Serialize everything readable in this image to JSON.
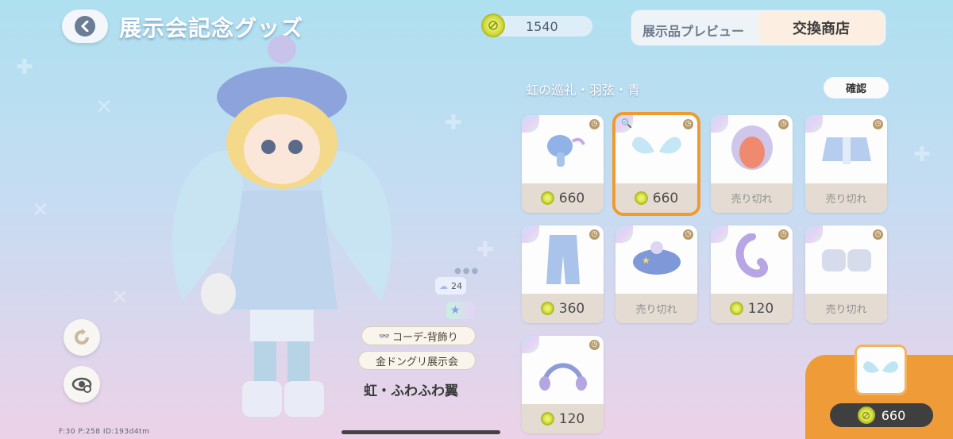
{
  "header": {
    "title": "展示会記念グッズ",
    "currency": "1540"
  },
  "tabs": {
    "preview": "展示品プレビュー",
    "shop": "交換商店"
  },
  "set_name": "虹の巡礼・羽弦・青",
  "confirm_label": "確認",
  "items": [
    {
      "name": "ribbon-hairdryer",
      "price": "660",
      "soldout": false,
      "selected": false
    },
    {
      "name": "angel-wings",
      "price": "660",
      "soldout": false,
      "selected": true
    },
    {
      "name": "lavender-bob-hair",
      "price": "",
      "soldout": true,
      "selected": false
    },
    {
      "name": "blue-jacket-top",
      "price": "",
      "soldout": true,
      "selected": false
    },
    {
      "name": "blue-pants",
      "price": "360",
      "soldout": false,
      "selected": false
    },
    {
      "name": "star-beret",
      "price": "",
      "soldout": true,
      "selected": false
    },
    {
      "name": "purple-ponytail",
      "price": "120",
      "soldout": false,
      "selected": false
    },
    {
      "name": "silver-sneakers",
      "price": "",
      "soldout": true,
      "selected": false
    },
    {
      "name": "purple-headband",
      "price": "120",
      "soldout": false,
      "selected": false
    }
  ],
  "soldout_label": "売り切れ",
  "stats": {
    "likes": "24",
    "category": "コーデ-背飾り",
    "exhibition": "金ドングリ展示会",
    "item_name": "虹・ふわふわ翼"
  },
  "purchase": {
    "price": "660"
  },
  "debug": "F:30   P:258   ID:193d4tm",
  "colors": {
    "accent": "#ef9b37",
    "coin": "#d9e04a",
    "price_bar": "#e4dcd2"
  }
}
